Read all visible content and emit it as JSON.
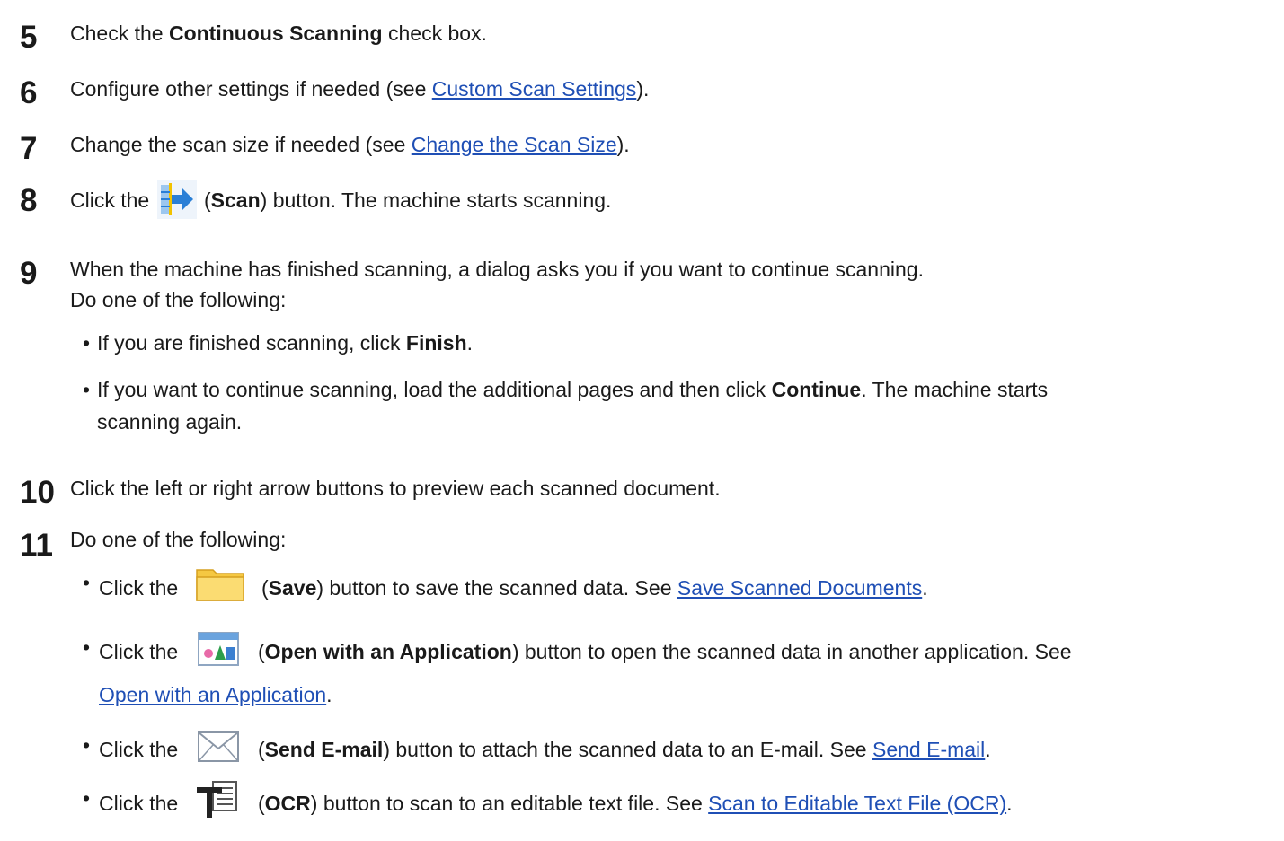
{
  "steps": [
    {
      "num": "5",
      "pre": "Check the ",
      "bold": "Continuous Scanning",
      "post": " check box."
    },
    {
      "num": "6",
      "pre": "Configure other settings if needed (see ",
      "link": "Custom Scan Settings",
      "post": ")."
    },
    {
      "num": "7",
      "pre": "Change the scan size if needed (see ",
      "link": "Change the Scan Size",
      "post": ")."
    },
    {
      "num": "8",
      "pre": "Click the ",
      "icon": "scan-icon",
      "paren_open": " (",
      "bold": "Scan",
      "post": ") button. The machine starts scanning."
    },
    {
      "num": "9",
      "line1": "When the machine has finished scanning, a dialog asks you if you want to continue scanning.",
      "line2": "Do one of the following:"
    },
    {
      "num": "10",
      "text": "Click the left or right arrow buttons to preview each scanned document."
    },
    {
      "num": "11",
      "text": "Do one of the following:"
    }
  ],
  "step9_bullets": [
    {
      "pre": "If you are finished scanning, click ",
      "bold": "Finish",
      "post": "."
    },
    {
      "pre": "If you want to continue scanning, load the additional pages and then click ",
      "bold": "Continue",
      "post": ". The machine starts",
      "line2": "scanning again."
    }
  ],
  "step11_bullets": [
    {
      "pre": "Click the ",
      "icon": "folder-icon",
      "paren": " (",
      "bold": "Save",
      "post": ") button to save the scanned data. See ",
      "link": "Save Scanned Documents",
      "end": "."
    },
    {
      "pre": "Click the ",
      "icon": "application-icon",
      "paren": " (",
      "bold": "Open with an Application",
      "post": ") button to open the scanned data in another application. See",
      "link": "Open with an Application",
      "end": "."
    },
    {
      "pre": "Click the ",
      "icon": "envelope-icon",
      "paren": " (",
      "bold": "Send E-mail",
      "post": ") button to attach the scanned data to an E-mail. See ",
      "link": "Send E-mail",
      "end": "."
    },
    {
      "pre": "Click the ",
      "icon": "ocr-icon",
      "paren": " (",
      "bold": "OCR",
      "post": ") button to scan to an editable text file. See ",
      "link": "Scan to Editable Text File (OCR)",
      "end": "."
    }
  ],
  "bullet_char": "•",
  "colors": {
    "link": "#1f4fb5",
    "text": "#1a1a1a",
    "scan_blue": "#2a7fd6",
    "scan_yellow": "#f2c200",
    "folder": "#f5c842"
  }
}
